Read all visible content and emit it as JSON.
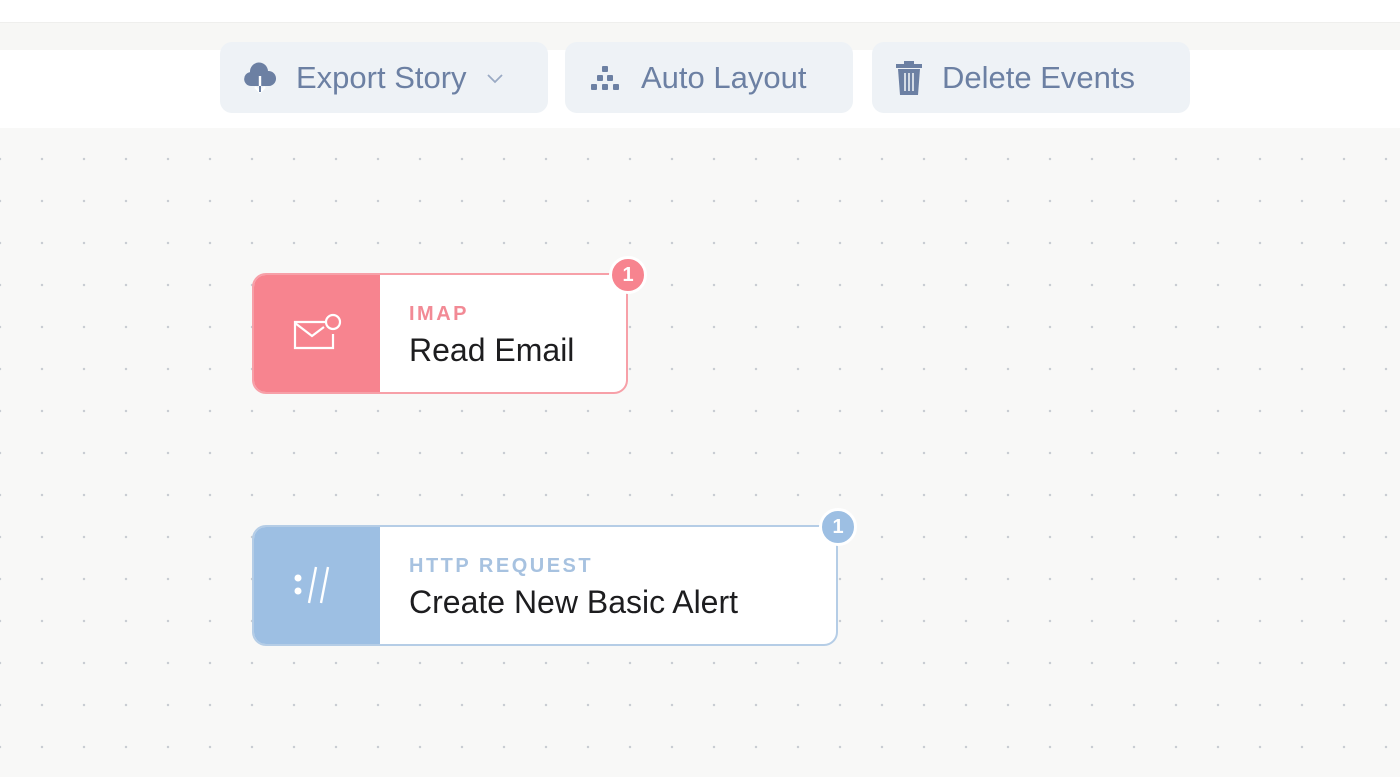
{
  "toolbar": {
    "export_label": "Export Story",
    "auto_layout_label": "Auto Layout",
    "delete_label": "Delete Events"
  },
  "nodes": [
    {
      "type": "IMAP",
      "name": "Read Email",
      "badge": "1",
      "color": "#f7848f",
      "icon": "envelope-icon"
    },
    {
      "type": "HTTP REQUEST",
      "name": "Create New Basic Alert",
      "badge": "1",
      "color": "#9dbfe3",
      "icon": "http-icon"
    }
  ]
}
